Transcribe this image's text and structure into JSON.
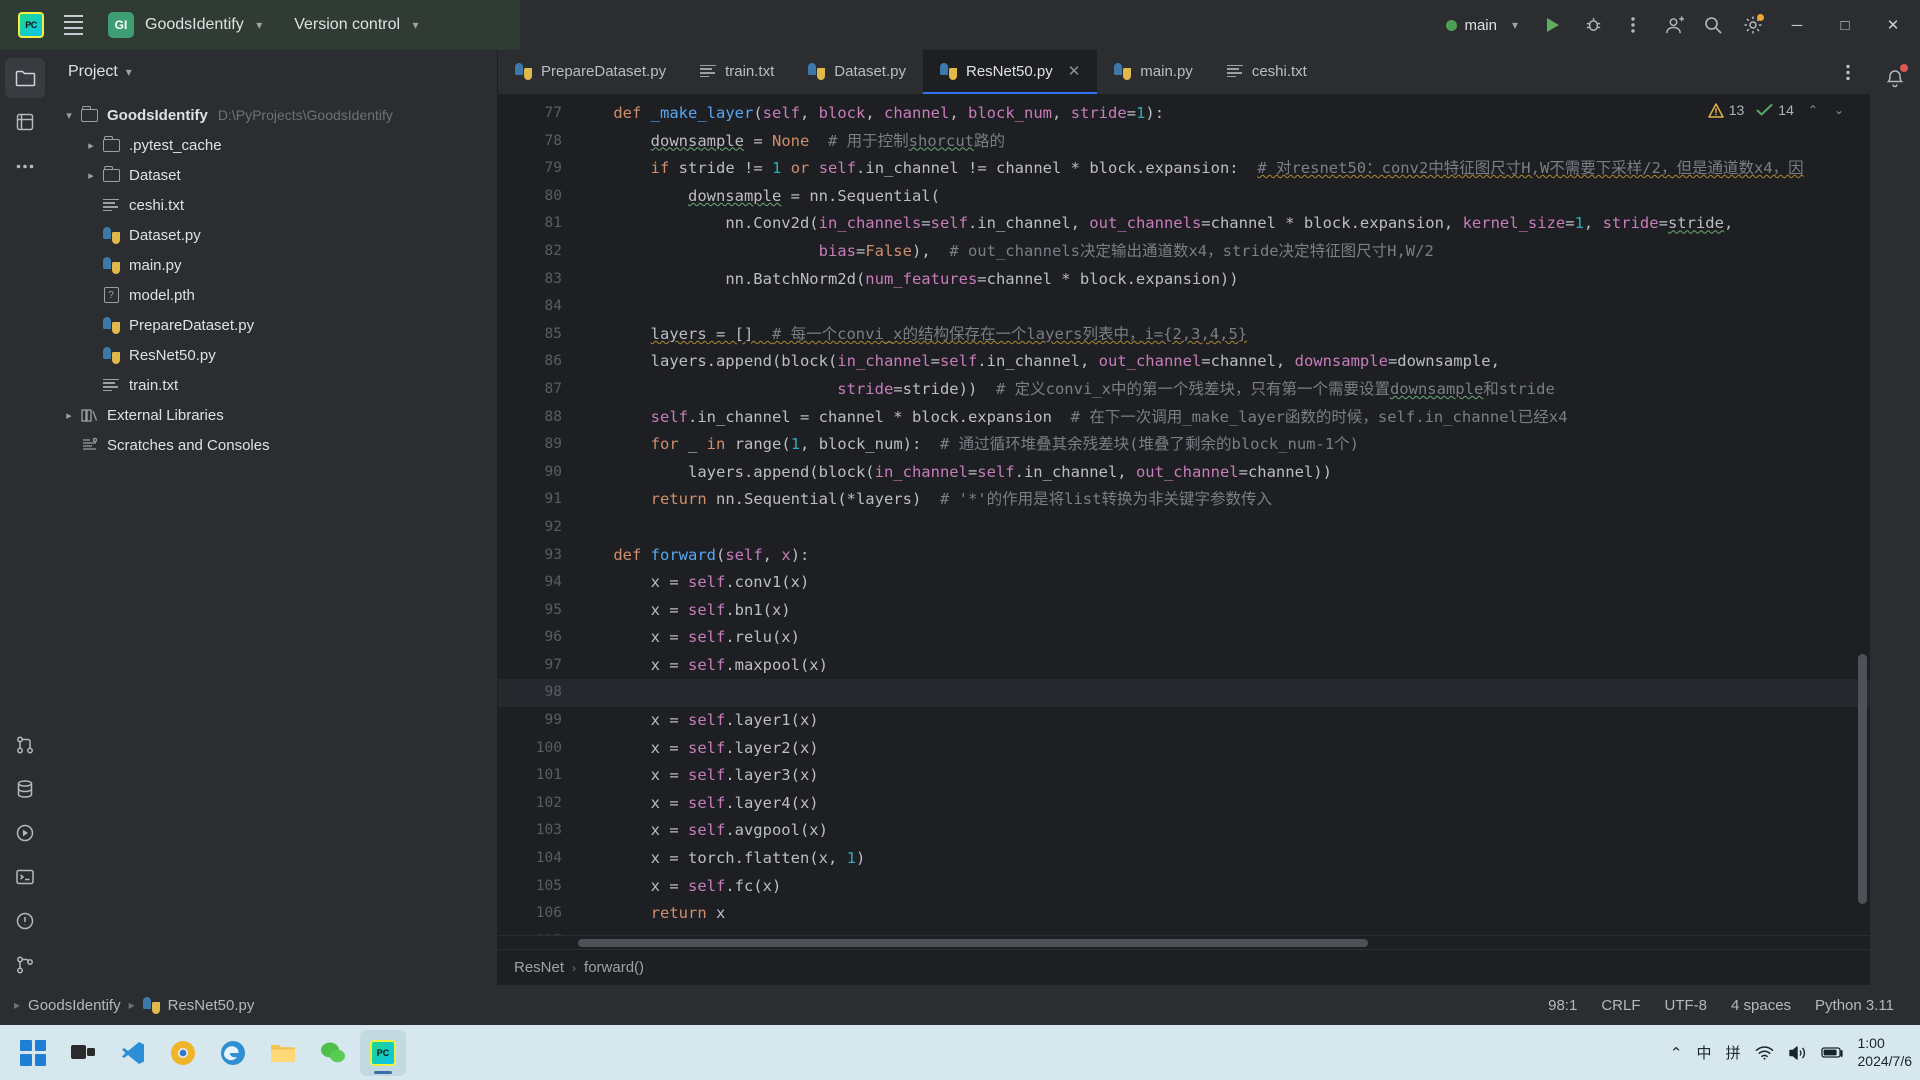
{
  "titlebar": {
    "app_icon": "pycharm-logo",
    "menu_icon": "hamburger-menu-icon",
    "project_badge": "GI",
    "project_name": "GoodsIdentify",
    "version_control": "Version control",
    "run_config": "main",
    "icons": {
      "run": "run-icon",
      "debug": "debug-icon",
      "more": "more-actions-icon",
      "account": "account-icon",
      "search": "search-icon",
      "settings": "settings-icon"
    },
    "window_controls": {
      "minimize": "─",
      "maximize": "□",
      "close": "✕"
    }
  },
  "left_rail": [
    {
      "name": "project-tool-window",
      "icon": "folder-icon",
      "active": true
    },
    {
      "name": "commit-tool-window",
      "icon": "commit-icon",
      "active": false
    },
    {
      "name": "more-tool-windows",
      "icon": "ellipsis-icon",
      "active": false
    },
    {
      "name": "pull-requests",
      "icon": "pull-request-icon",
      "active": false
    },
    {
      "name": "database",
      "icon": "database-icon",
      "active": false
    },
    {
      "name": "run-tool-window",
      "icon": "run-circle-icon",
      "active": false
    },
    {
      "name": "terminal-tool-window",
      "icon": "terminal-icon",
      "active": false
    },
    {
      "name": "problems-tool-window",
      "icon": "problems-icon",
      "active": false
    },
    {
      "name": "version-control-tool-window",
      "icon": "branch-icon",
      "active": false
    }
  ],
  "project_panel": {
    "header": "Project",
    "header_chevron": "chevron-down-icon",
    "tree": [
      {
        "label": "GoodsIdentify",
        "path": "D:\\PyProjects\\GoodsIdentify",
        "icon": "folder",
        "arrow": "expanded",
        "depth": 0,
        "bold": true
      },
      {
        "label": ".pytest_cache",
        "path": "",
        "icon": "folder",
        "arrow": "collapsed",
        "depth": 1,
        "bold": false
      },
      {
        "label": "Dataset",
        "path": "",
        "icon": "folder",
        "arrow": "collapsed",
        "depth": 1,
        "bold": false
      },
      {
        "label": "ceshi.txt",
        "path": "",
        "icon": "txt",
        "arrow": "none",
        "depth": 1,
        "bold": false
      },
      {
        "label": "Dataset.py",
        "path": "",
        "icon": "python",
        "arrow": "none",
        "depth": 1,
        "bold": false
      },
      {
        "label": "main.py",
        "path": "",
        "icon": "python",
        "arrow": "none",
        "depth": 1,
        "bold": false
      },
      {
        "label": "model.pth",
        "path": "",
        "icon": "unknown",
        "arrow": "none",
        "depth": 1,
        "bold": false
      },
      {
        "label": "PrepareDataset.py",
        "path": "",
        "icon": "python",
        "arrow": "none",
        "depth": 1,
        "bold": false
      },
      {
        "label": "ResNet50.py",
        "path": "",
        "icon": "python",
        "arrow": "none",
        "depth": 1,
        "bold": false
      },
      {
        "label": "train.txt",
        "path": "",
        "icon": "txt",
        "arrow": "none",
        "depth": 1,
        "bold": false
      },
      {
        "label": "External Libraries",
        "path": "",
        "icon": "library",
        "arrow": "collapsed",
        "depth": 0,
        "bold": false
      },
      {
        "label": "Scratches and Consoles",
        "path": "",
        "icon": "scratch",
        "arrow": "none",
        "depth": 0,
        "bold": false
      }
    ]
  },
  "tabs": [
    {
      "label": "PrepareDataset.py",
      "icon": "python",
      "active": false,
      "closable": false
    },
    {
      "label": "train.txt",
      "icon": "txt",
      "active": false,
      "closable": false
    },
    {
      "label": "Dataset.py",
      "icon": "python",
      "active": false,
      "closable": false
    },
    {
      "label": "ResNet50.py",
      "icon": "python",
      "active": true,
      "closable": true
    },
    {
      "label": "main.py",
      "icon": "python",
      "active": false,
      "closable": false
    },
    {
      "label": "ceshi.txt",
      "icon": "txt",
      "active": false,
      "closable": false
    }
  ],
  "tab_more_icon": "more-tabs-icon",
  "inspections": {
    "warning_icon": "warning-triangle-icon",
    "warning_count": "13",
    "ok_icon": "checkmark-icon",
    "ok_count": "14",
    "prev_icon": "⌃",
    "next_icon": "⌄"
  },
  "code": {
    "current_line": 98,
    "lines": [
      {
        "n": 77,
        "html": "    <span class=\"kw\">def</span> <span class=\"fn\">_make_layer</span><span class=\"plain\">(</span><span class=\"self\">self</span><span class=\"plain\">, </span><span class=\"param\">block</span><span class=\"plain\">, </span><span class=\"param\">channel</span><span class=\"plain\">, </span><span class=\"param\">block_num</span><span class=\"plain\">, </span><span class=\"param\">stride</span><span class=\"plain\">=</span><span class=\"num\">1</span><span class=\"plain\">):</span>"
      },
      {
        "n": 78,
        "html": "        <span class=\"plain err-u\">downsample</span> <span class=\"plain\">= </span><span class=\"kw\">None</span>  <span class=\"cmt\"># 用于控制</span><span class=\"cmt err-u\">shorcut</span><span class=\"cmt\">路的</span>"
      },
      {
        "n": 79,
        "html": "        <span class=\"kw\">if</span> <span class=\"plain\">stride != </span><span class=\"num\">1</span> <span class=\"kw\">or</span> <span class=\"self\">self</span><span class=\"plain\">.in_channel != channel * block.expansion:</span>  <span class=\"cmt warn-u\"># 对resnet50：conv2中特征图尺寸H,W不需要下采样/2，但是通道数x4，因</span>"
      },
      {
        "n": 80,
        "html": "            <span class=\"plain err-u\">downsample</span> <span class=\"plain\">= nn.Sequential(</span>"
      },
      {
        "n": 81,
        "html": "                <span class=\"plain\">nn.Conv2d(</span><span class=\"kwarg\">in_channels</span><span class=\"plain\">=</span><span class=\"self\">self</span><span class=\"plain\">.in_channel, </span><span class=\"kwarg\">out_channels</span><span class=\"plain\">=channel * block.expansion, </span><span class=\"kwarg\">kernel_size</span><span class=\"plain\">=</span><span class=\"num\">1</span><span class=\"plain\">, </span><span class=\"kwarg\">stride</span><span class=\"plain\">=</span><span class=\"plain err-u\">stride</span><span class=\"plain\">,</span>"
      },
      {
        "n": 82,
        "html": "                          <span class=\"kwarg\">bias</span><span class=\"plain\">=</span><span class=\"kw\">False</span><span class=\"plain\">),  </span><span class=\"cmt\"># out_channels决定输出通道数x4，stride决定特征图尺寸H,W/2</span>"
      },
      {
        "n": 83,
        "html": "                <span class=\"plain\">nn.BatchNorm2d(</span><span class=\"kwarg\">num_features</span><span class=\"plain\">=channel * block.expansion))</span>"
      },
      {
        "n": 84,
        "html": ""
      },
      {
        "n": 85,
        "html": "        <span class=\"plain warn-u\">layers = []  </span><span class=\"cmt warn-u\"># 每一个convi_x的结构保存在一个layers列表中，i={2,3,4,5}</span>"
      },
      {
        "n": 86,
        "html": "        <span class=\"plain\">layers.append(block(</span><span class=\"kwarg\">in_channel</span><span class=\"plain\">=</span><span class=\"self\">self</span><span class=\"plain\">.in_channel, </span><span class=\"kwarg\">out_channel</span><span class=\"plain\">=channel, </span><span class=\"kwarg\">downsample</span><span class=\"plain\">=downsample,</span>"
      },
      {
        "n": 87,
        "html": "                            <span class=\"kwarg\">stride</span><span class=\"plain\">=stride))  </span><span class=\"cmt\"># 定义convi_x中的第一个残差块，只有第一个需要设置</span><span class=\"cmt err-u\">downsample</span><span class=\"cmt\">和stride</span>"
      },
      {
        "n": 88,
        "html": "        <span class=\"self\">self</span><span class=\"plain\">.in_channel = channel * block.expansion  </span><span class=\"cmt\"># 在下一次调用_make_layer函数的时候，self.in_channel已经x4</span>"
      },
      {
        "n": 89,
        "html": "        <span class=\"kw\">for</span> <span class=\"plain\">_ </span><span class=\"kw\">in</span> <span class=\"plain\">range(</span><span class=\"num\">1</span><span class=\"plain\">, block_num):  </span><span class=\"cmt\"># 通过循环堆叠其余残差块(堆叠了剩余的block_num-1个)</span>"
      },
      {
        "n": 90,
        "html": "            <span class=\"plain\">layers.append(block(</span><span class=\"kwarg\">in_channel</span><span class=\"plain\">=</span><span class=\"self\">self</span><span class=\"plain\">.in_channel, </span><span class=\"kwarg\">out_channel</span><span class=\"plain\">=channel))</span>"
      },
      {
        "n": 91,
        "html": "        <span class=\"kw\">return</span> <span class=\"plain\">nn.Sequential(*layers)  </span><span class=\"cmt\"># '*'的作用是将list转换为非关键字参数传入</span>"
      },
      {
        "n": 92,
        "html": ""
      },
      {
        "n": 93,
        "html": "    <span class=\"kw\">def</span> <span class=\"fn\">forward</span><span class=\"plain\">(</span><span class=\"self\">self</span><span class=\"plain\">, </span><span class=\"param\">x</span><span class=\"plain\">):</span>"
      },
      {
        "n": 94,
        "html": "        <span class=\"plain\">x = </span><span class=\"self\">self</span><span class=\"plain\">.conv1(x)</span>"
      },
      {
        "n": 95,
        "html": "        <span class=\"plain\">x = </span><span class=\"self\">self</span><span class=\"plain\">.bn1(x)</span>"
      },
      {
        "n": 96,
        "html": "        <span class=\"plain\">x = </span><span class=\"self\">self</span><span class=\"plain\">.relu(x)</span>"
      },
      {
        "n": 97,
        "html": "        <span class=\"plain\">x = </span><span class=\"self\">self</span><span class=\"plain\">.maxpool(x)</span>"
      },
      {
        "n": 98,
        "html": ""
      },
      {
        "n": 99,
        "html": "        <span class=\"plain\">x = </span><span class=\"self\">self</span><span class=\"plain\">.layer1(x)</span>"
      },
      {
        "n": 100,
        "html": "        <span class=\"plain\">x = </span><span class=\"self\">self</span><span class=\"plain\">.layer2(x)</span>"
      },
      {
        "n": 101,
        "html": "        <span class=\"plain\">x = </span><span class=\"self\">self</span><span class=\"plain\">.layer3(x)</span>"
      },
      {
        "n": 102,
        "html": "        <span class=\"plain\">x = </span><span class=\"self\">self</span><span class=\"plain\">.layer4(x)</span>"
      },
      {
        "n": 103,
        "html": "        <span class=\"plain\">x = </span><span class=\"self\">self</span><span class=\"plain\">.avgpool(x)</span>"
      },
      {
        "n": 104,
        "html": "        <span class=\"plain\">x = torch.flatten(x, </span><span class=\"num\">1</span><span class=\"plain\">)</span>"
      },
      {
        "n": 105,
        "html": "        <span class=\"plain\">x = </span><span class=\"self\">self</span><span class=\"plain\">.fc(x)</span>"
      },
      {
        "n": 106,
        "html": "        <span class=\"kw\">return</span> <span class=\"plain\">x</span>"
      },
      {
        "n": 107,
        "html": ""
      }
    ]
  },
  "breadcrumb": {
    "class": "ResNet",
    "separator": "›",
    "method": "forward()"
  },
  "statusbar": {
    "project": "GoodsIdentify",
    "file": "ResNet50.py",
    "caret": "98:1",
    "line_sep": "CRLF",
    "encoding": "UTF-8",
    "indent": "4 spaces",
    "interpreter": "Python 3.11"
  },
  "right_rail": {
    "notifications_icon": "bell-icon"
  },
  "taskbar": {
    "start": "windows-start-icon",
    "items": [
      {
        "name": "task-view",
        "icon": "task-view-icon",
        "active": false
      },
      {
        "name": "vscode",
        "icon": "vscode-icon",
        "active": false
      },
      {
        "name": "chrome-canary",
        "icon": "chrome-canary-icon",
        "active": false
      },
      {
        "name": "edge",
        "icon": "edge-icon",
        "active": false
      },
      {
        "name": "file-explorer",
        "icon": "folder-icon",
        "active": false
      },
      {
        "name": "wechat",
        "icon": "wechat-icon",
        "active": false
      },
      {
        "name": "pycharm",
        "icon": "pycharm-icon",
        "active": true
      }
    ],
    "tray": {
      "chevron": "⌃",
      "ime_mode": "中",
      "ime_pinyin": "拼",
      "wifi": "wifi-icon",
      "volume": "volume-icon",
      "battery": "battery-icon"
    },
    "clock_time": "1:00",
    "clock_date": "2024/7/6"
  }
}
